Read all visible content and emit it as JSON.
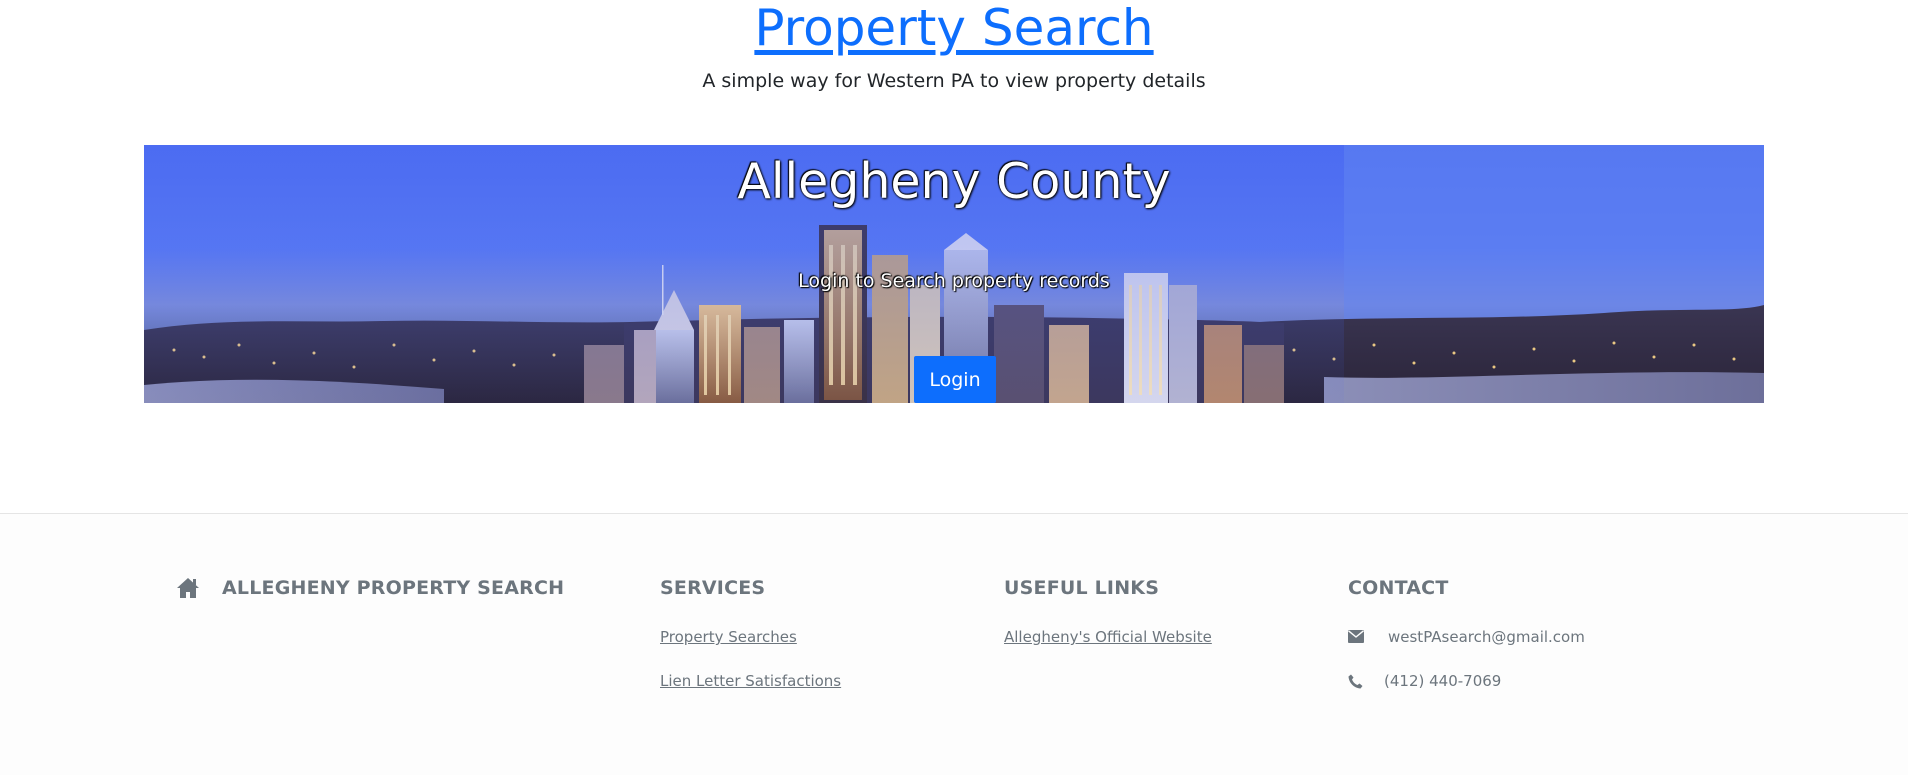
{
  "header": {
    "title": "Property Search",
    "subtitle": "A simple way for Western PA to view property details"
  },
  "hero": {
    "title": "Allegheny County",
    "tagline": "Login to Search property records",
    "login_label": "Login"
  },
  "footer": {
    "brand": {
      "icon": "home-icon",
      "label": "ALLEGHENY PROPERTY SEARCH"
    },
    "services": {
      "heading": "SERVICES",
      "links": [
        "Property Searches",
        "Lien Letter Satisfactions"
      ]
    },
    "useful_links": {
      "heading": "USEFUL LINKS",
      "links": [
        "Allegheny's Official Website"
      ]
    },
    "contact": {
      "heading": "CONTACT",
      "email_icon": "envelope-icon",
      "email": "westPAsearch@gmail.com",
      "phone_icon": "phone-icon",
      "phone": "(412) 440-7069"
    }
  },
  "colors": {
    "link": "#0d6efd",
    "button": "#0d6efd",
    "footer_text": "#6c757d",
    "sky": "#5a7bf2"
  }
}
